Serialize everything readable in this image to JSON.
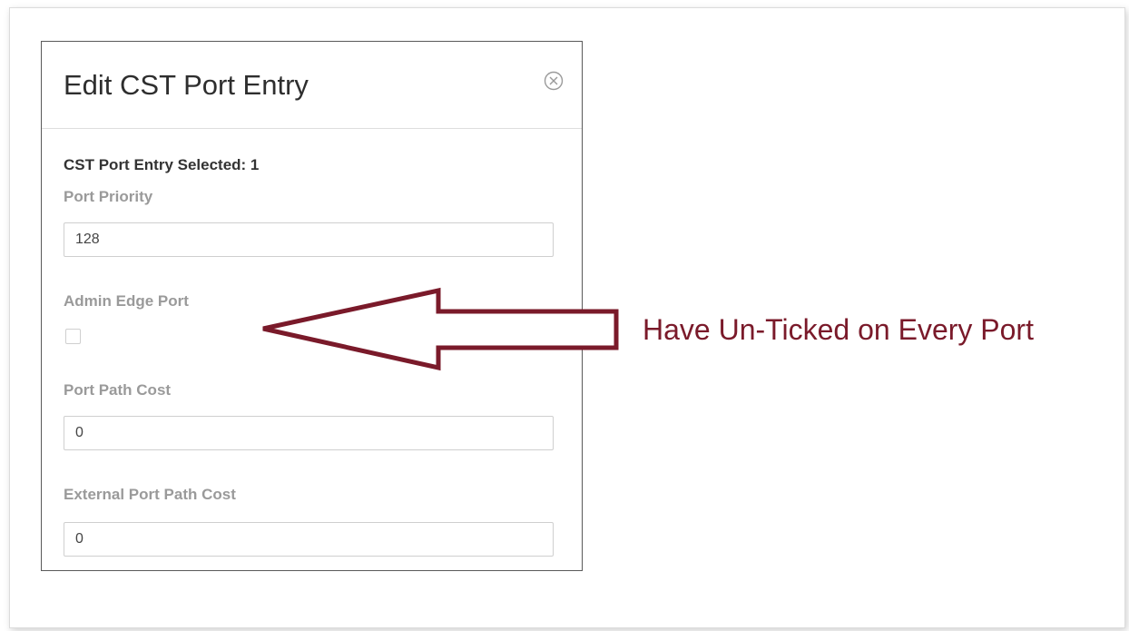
{
  "dialog": {
    "title": "Edit CST Port Entry",
    "selected_label": "CST Port Entry Selected: 1",
    "fields": {
      "port_priority": {
        "label": "Port Priority",
        "value": "128"
      },
      "admin_edge_port": {
        "label": "Admin Edge Port",
        "checked": false
      },
      "port_path_cost": {
        "label": "Port Path Cost",
        "value": "0"
      },
      "external_port_path_cost": {
        "label": "External Port Path Cost",
        "value": "0"
      }
    }
  },
  "annotation": {
    "text": "Have Un-Ticked on Every Port",
    "color": "#7a1a2a"
  },
  "icons": {
    "close": "close-circle-icon",
    "arrow": "left-arrow-icon"
  }
}
